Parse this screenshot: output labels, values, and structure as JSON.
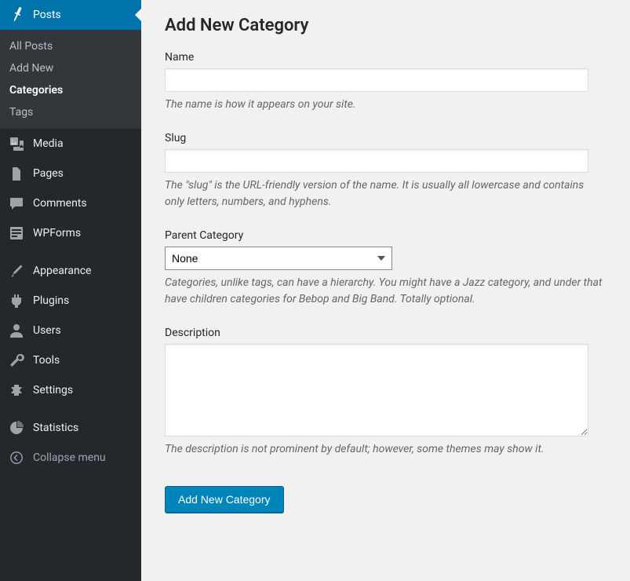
{
  "sidebar": {
    "posts": {
      "label": "Posts"
    },
    "submenu": {
      "all_posts": "All Posts",
      "add_new": "Add New",
      "categories": "Categories",
      "tags": "Tags"
    },
    "media": "Media",
    "pages": "Pages",
    "comments": "Comments",
    "wpforms": "WPForms",
    "appearance": "Appearance",
    "plugins": "Plugins",
    "users": "Users",
    "tools": "Tools",
    "settings": "Settings",
    "statistics": "Statistics",
    "collapse": "Collapse menu"
  },
  "main": {
    "title": "Add New Category",
    "name_label": "Name",
    "name_help": "The name is how it appears on your site.",
    "slug_label": "Slug",
    "slug_help": "The \"slug\" is the URL-friendly version of the name. It is usually all lowercase and contains only letters, numbers, and hyphens.",
    "parent_label": "Parent Category",
    "parent_value": "None",
    "parent_help": "Categories, unlike tags, can have a hierarchy. You might have a Jazz category, and under that have children categories for Bebop and Big Band. Totally optional.",
    "description_label": "Description",
    "description_help": "The description is not prominent by default; however, some themes may show it.",
    "submit_label": "Add New Category"
  }
}
